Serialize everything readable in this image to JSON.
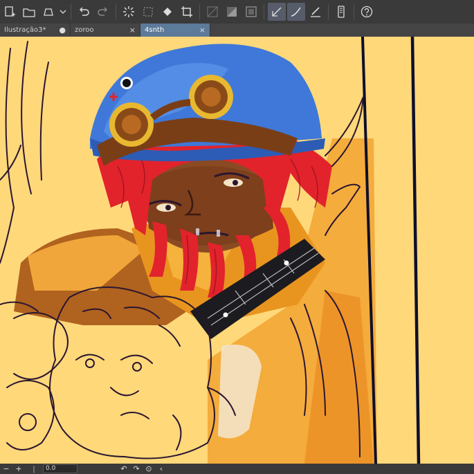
{
  "toolbar": {
    "icons": [
      "new-file-icon",
      "open-folder-icon",
      "save-icon",
      "dropdown-icon",
      "undo-icon",
      "redo-icon",
      "loading-icon",
      "transform-icon",
      "fill-icon",
      "crop-icon",
      "grid-icon",
      "tone-icon",
      "border-icon",
      "pen-icon",
      "eraser-icon",
      "brush-size-icon",
      "device-icon",
      "help-icon"
    ]
  },
  "tabs": [
    {
      "label": "Ilustração3*",
      "close": "●"
    },
    {
      "label": "zoroo",
      "close": "×"
    },
    {
      "label": "4snth",
      "close": "×"
    }
  ],
  "status": {
    "zoom_value": "0.0",
    "minus": "−",
    "plus": "+"
  },
  "colors": {
    "canvas_bg": "#ffd87a",
    "active_tab": "#5c7a99",
    "hat": "#3f78d8",
    "hair": "#e2232c",
    "skin": "#8a4a24",
    "line": "#2a1630"
  }
}
